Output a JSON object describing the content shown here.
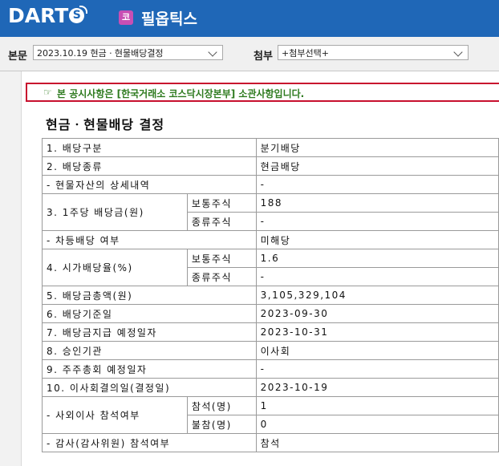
{
  "header": {
    "logo_prefix": "DART",
    "logo_o": "S",
    "market_badge": "코",
    "company_name": "필옵틱스"
  },
  "toolbar": {
    "main_label": "본문",
    "main_value": "2023.10.19  현금ㆍ현물배당결정",
    "attach_label": "첨부",
    "attach_value": "+첨부선택+"
  },
  "notice": {
    "icon": "☞",
    "text": "본 공시사항은 [한국거래소 코스닥시장본부] 소관사항입니다."
  },
  "doc_title": "현금ㆍ현물배당 결정",
  "table": {
    "r1": {
      "label": "1. 배당구분",
      "value": "분기배당"
    },
    "r2": {
      "label": "2. 배당종류",
      "value": "현금배당"
    },
    "r3": {
      "label": "- 현물자산의 상세내역",
      "value": "-"
    },
    "r4": {
      "label": "3. 1주당 배당금(원)",
      "sub1": "보통주식",
      "val1": "188",
      "sub2": "종류주식",
      "val2": "-"
    },
    "r5": {
      "label": "- 차등배당 여부",
      "value": "미해당"
    },
    "r6": {
      "label": "4. 시가배당율(%)",
      "sub1": "보통주식",
      "val1": "1.6",
      "sub2": "종류주식",
      "val2": "-"
    },
    "r7": {
      "label": "5. 배당금총액(원)",
      "value": "3,105,329,104"
    },
    "r8": {
      "label": "6. 배당기준일",
      "value": "2023-09-30"
    },
    "r9": {
      "label": "7. 배당금지급 예정일자",
      "value": "2023-10-31"
    },
    "r10": {
      "label": "8. 승인기관",
      "value": "이사회"
    },
    "r11": {
      "label": "9. 주주총회 예정일자",
      "value": "-"
    },
    "r12": {
      "label": "10. 이사회결의일(결정일)",
      "value": "2023-10-19"
    },
    "r13": {
      "label": "- 사외이사 참석여부",
      "sub1": "참석(명)",
      "val1": "1",
      "sub2": "불참(명)",
      "val2": "0"
    },
    "r14": {
      "label": "- 감사(감사위원) 참석여부",
      "value": "참석"
    }
  }
}
